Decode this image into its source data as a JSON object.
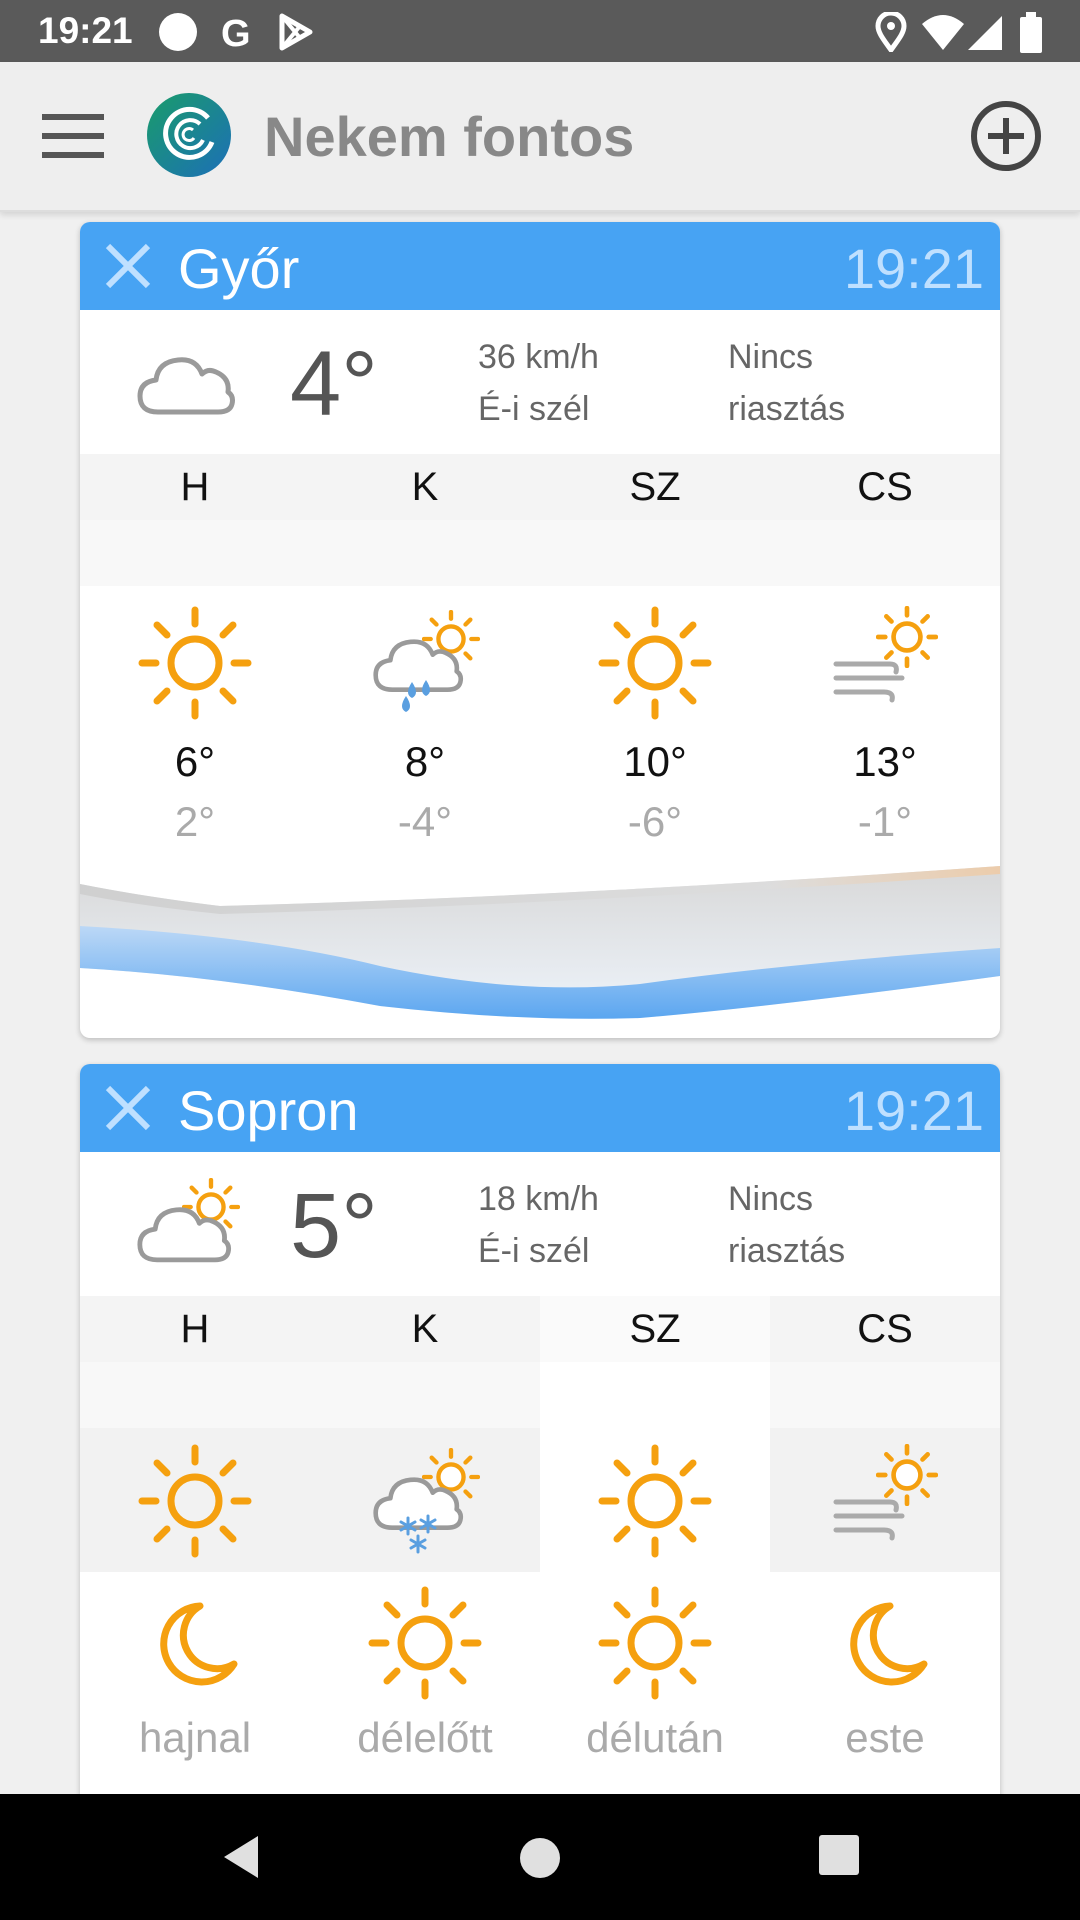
{
  "status_bar": {
    "time": "19:21",
    "icons": [
      "circle-icon",
      "google-icon",
      "play-store-icon",
      "location-icon",
      "wifi-icon",
      "signal-icon",
      "battery-icon"
    ]
  },
  "toolbar": {
    "title": "Nekem fontos",
    "menu_icon": "hamburger-menu-icon",
    "logo_icon": "app-logo-icon",
    "add_icon": "add-circle-icon"
  },
  "colors": {
    "header_blue": "#47a3f3",
    "sun_orange": "#f5a00f",
    "rain_blue": "#5a9fe0"
  },
  "cards": [
    {
      "city": "Győr",
      "time": "19:21",
      "current": {
        "icon": "cloud-icon",
        "temp": "4°",
        "wind_speed": "36 km/h",
        "wind_dir": "É-i szél",
        "alert_line1": "Nincs",
        "alert_line2": "riasztás"
      },
      "days": [
        "H",
        "K",
        "SZ",
        "CS"
      ],
      "forecast": [
        {
          "icon": "sun-icon",
          "hi": "6°",
          "lo": "2°"
        },
        {
          "icon": "rain-cloud-sun-icon",
          "hi": "8°",
          "lo": "-4°"
        },
        {
          "icon": "sun-icon",
          "hi": "10°",
          "lo": "-6°"
        },
        {
          "icon": "wind-sun-icon",
          "hi": "13°",
          "lo": "-1°"
        }
      ]
    },
    {
      "city": "Sopron",
      "time": "19:21",
      "current": {
        "icon": "cloud-sun-icon",
        "temp": "5°",
        "wind_speed": "18 km/h",
        "wind_dir": "É-i szél",
        "alert_line1": "Nincs",
        "alert_line2": "riasztás"
      },
      "days": [
        "H",
        "K",
        "SZ",
        "CS"
      ],
      "forecast_icons": [
        "sun-icon",
        "snow-cloud-sun-icon",
        "sun-icon",
        "wind-sun-icon"
      ],
      "periods": [
        {
          "icon": "moon-icon",
          "label": "hajnal"
        },
        {
          "icon": "sun-icon",
          "label": "délelőtt"
        },
        {
          "icon": "sun-icon",
          "label": "délután"
        },
        {
          "icon": "moon-icon",
          "label": "este"
        }
      ]
    }
  ],
  "nav_bar": [
    "back-icon",
    "home-icon",
    "recents-icon"
  ]
}
